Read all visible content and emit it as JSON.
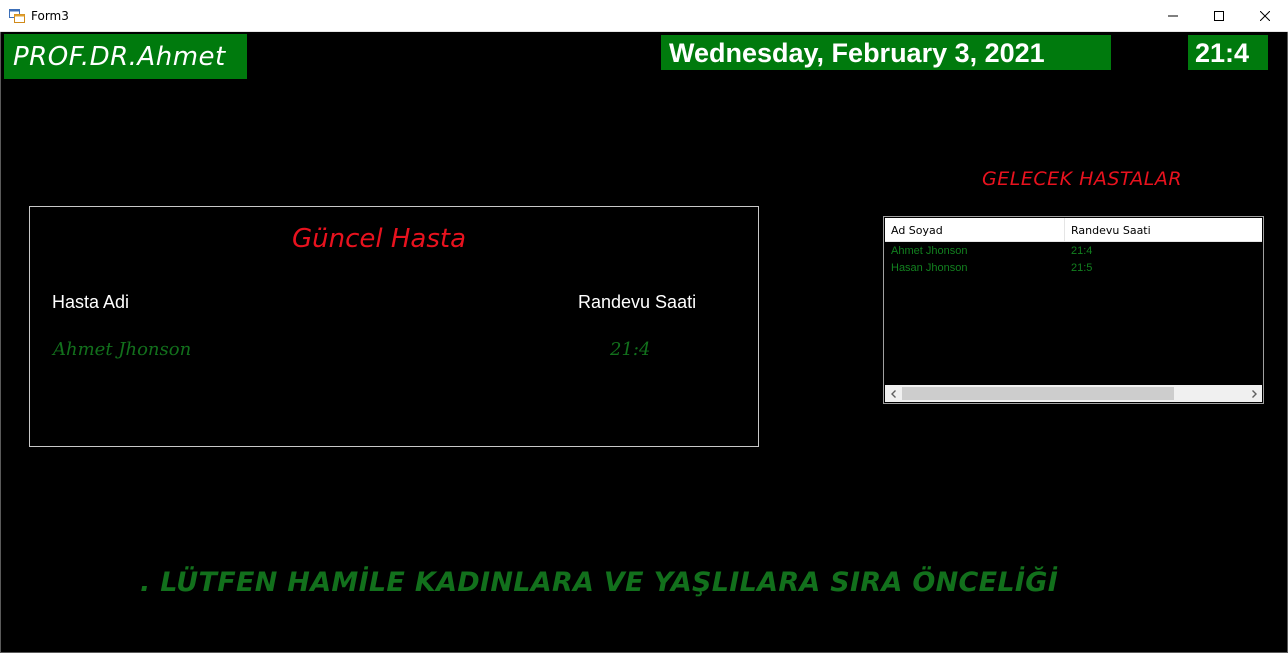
{
  "window": {
    "title": "Form3",
    "icon": "form-app-icon"
  },
  "header": {
    "doctor_name": "PROF.DR.Ahmet",
    "date": "Wednesday, February 3, 2021",
    "time": "21:4"
  },
  "current": {
    "title": "Güncel Hasta",
    "patient_header": "Hasta Adi",
    "time_header": "Randevu Saati",
    "patient_name": "Ahmet Jhonson",
    "appointment_time": "21:4"
  },
  "upcoming": {
    "title": "GELECEK HASTALAR",
    "columns": [
      "Ad Soyad",
      "Randevu Saati"
    ],
    "rows": [
      {
        "name": "Ahmet Jhonson",
        "time": "21:4"
      },
      {
        "name": "Hasan Jhonson",
        "time": "21:5"
      }
    ]
  },
  "notice": ".  LÜTFEN HAMİLE KADINLARA VE YAŞLILARA SIRA ÖNCELİĞİ",
  "colors": {
    "accent_green": "#007a0d",
    "text_green": "#12701c",
    "title_red": "#e8121e"
  }
}
